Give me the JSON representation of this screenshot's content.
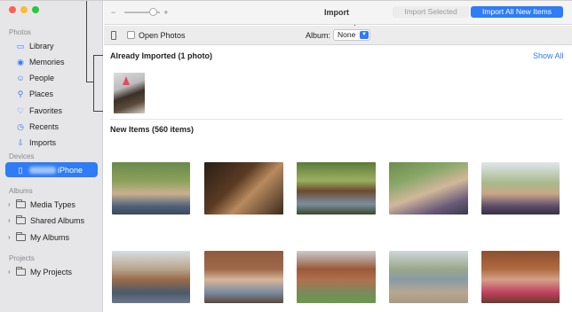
{
  "window": {
    "traffic_lights": {
      "close": "#fe5f57",
      "minimize": "#febc2e",
      "zoom": "#28c840"
    }
  },
  "toolbar": {
    "zoom_minus": "−",
    "zoom_plus": "+",
    "title": "Import",
    "import_selected_label": "Import Selected",
    "import_all_label": "Import All New Items"
  },
  "options": {
    "open_photos_label": "Open Photos",
    "album_label": "Album:",
    "album_value": "None"
  },
  "sidebar": {
    "photos_header": "Photos",
    "photos_items": [
      {
        "label": "Library",
        "icon": "library-icon"
      },
      {
        "label": "Memories",
        "icon": "memories-icon"
      },
      {
        "label": "People",
        "icon": "people-icon"
      },
      {
        "label": "Places",
        "icon": "places-icon"
      },
      {
        "label": "Favorites",
        "icon": "heart-icon"
      },
      {
        "label": "Recents",
        "icon": "clock-icon"
      },
      {
        "label": "Imports",
        "icon": "imports-icon"
      }
    ],
    "devices_header": "Devices",
    "device_label": "iPhone",
    "albums_header": "Albums",
    "album_items": [
      {
        "label": "Media Types"
      },
      {
        "label": "Shared Albums"
      },
      {
        "label": "My Albums"
      }
    ],
    "projects_header": "Projects",
    "project_items": [
      {
        "label": "My Projects"
      }
    ]
  },
  "content": {
    "already_imported_title": "Already Imported (1 photo)",
    "show_all_label": "Show All",
    "new_items_title": "New Items (560 items)"
  },
  "colors": {
    "accent": "#2e7cf6",
    "sidebar_bg": "#e6e6e8"
  }
}
